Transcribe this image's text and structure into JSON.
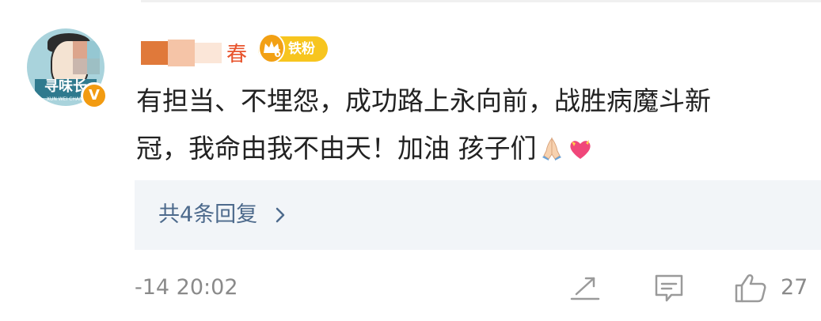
{
  "avatar": {
    "banner_text": "寻味长",
    "sub_text": "XUN WEI CHANG",
    "verified_mark": "V"
  },
  "user": {
    "name_suffix": "春",
    "badge_level": "6",
    "badge_label": "铁粉"
  },
  "comment": {
    "line1": "有担当、不埋怨，成功路上永向前，战胜病魔斗新",
    "line2": "冠，我命由我不由天！加油 孩子们",
    "emojis": [
      "folded-hands-icon",
      "heart-with-ribbon-icon"
    ]
  },
  "replies": {
    "label": "共4条回复"
  },
  "footer": {
    "timestamp": "-14 20:02",
    "like_count": "27"
  },
  "colors": {
    "link": "#4d6a8c",
    "badge": "#f7c51f",
    "verified": "#f29b11",
    "meta_text": "#8a8a8a",
    "comment_text": "#222222"
  }
}
